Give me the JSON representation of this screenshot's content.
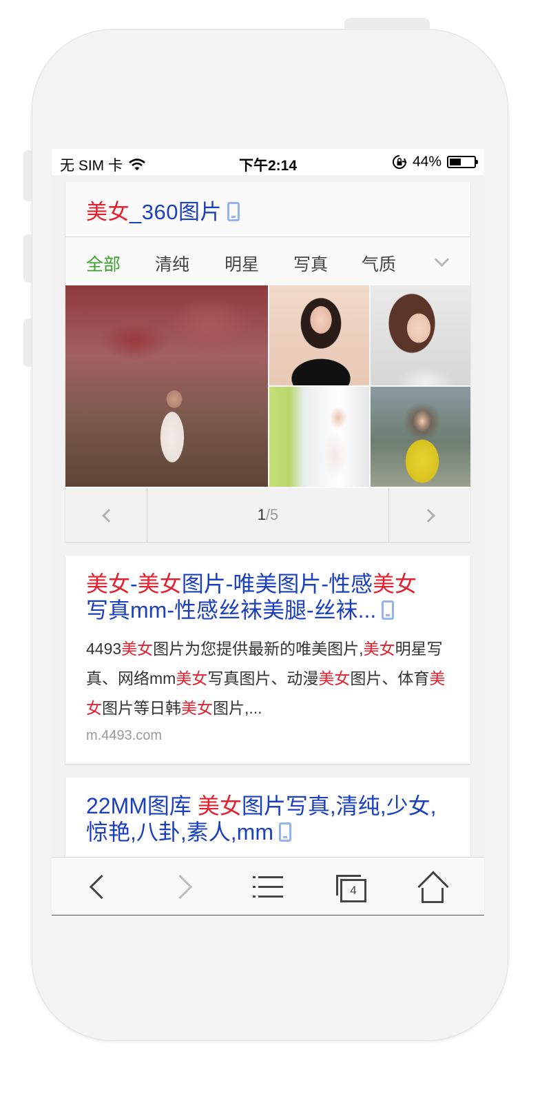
{
  "status_bar": {
    "carrier": "无 SIM 卡",
    "time": "下午2:14",
    "battery_percent": "44%",
    "battery_level": 0.44,
    "icons": [
      "wifi-icon",
      "orientation-lock-icon",
      "battery-icon"
    ]
  },
  "image_card": {
    "title_highlight": "美女",
    "title_rest": "_360图片",
    "tabs": [
      {
        "label": "全部",
        "active": true
      },
      {
        "label": "清纯",
        "active": false
      },
      {
        "label": "明星",
        "active": false
      },
      {
        "label": "写真",
        "active": false
      },
      {
        "label": "气质",
        "active": false
      }
    ],
    "pager": {
      "current": "1",
      "total": "/5"
    }
  },
  "results": [
    {
      "title_parts": [
        {
          "text": "美女",
          "hl": true
        },
        {
          "text": "-",
          "hl": false
        },
        {
          "text": "美女",
          "hl": true
        },
        {
          "text": "图片-唯美图片-性感",
          "hl": false
        },
        {
          "text": "美女",
          "hl": true
        },
        {
          "text": "写真mm-性感丝袜美腿-丝袜...",
          "hl": false
        }
      ],
      "snippet_parts": [
        {
          "text": "4493",
          "hl": false
        },
        {
          "text": "美女",
          "hl": true
        },
        {
          "text": "图片为您提供最新的唯美图片,",
          "hl": false
        },
        {
          "text": "美女",
          "hl": true
        },
        {
          "text": "明星写真、网络mm",
          "hl": false
        },
        {
          "text": "美女",
          "hl": true
        },
        {
          "text": "写真图片、动漫",
          "hl": false
        },
        {
          "text": "美女",
          "hl": true
        },
        {
          "text": "图片、体育",
          "hl": false
        },
        {
          "text": "美女",
          "hl": true
        },
        {
          "text": "图片等日韩",
          "hl": false
        },
        {
          "text": "美女",
          "hl": true
        },
        {
          "text": "图片,...",
          "hl": false
        }
      ],
      "url": "m.4493.com"
    },
    {
      "title_parts": [
        {
          "text": "22MM图库 ",
          "hl": false
        },
        {
          "text": "美女",
          "hl": true
        },
        {
          "text": "图片写真,清纯,少女,惊艳,八卦,素人,mm",
          "hl": false
        }
      ]
    }
  ],
  "toolbar": {
    "tabs_count": "4",
    "buttons": [
      "back-icon",
      "forward-icon",
      "bookmarks-icon",
      "tabs-icon",
      "home-icon"
    ]
  },
  "colors": {
    "highlight": "#e5202e",
    "link": "#1a3fbf",
    "active_tab": "#3aa12e",
    "mobile_icon": "#93b4ef"
  }
}
